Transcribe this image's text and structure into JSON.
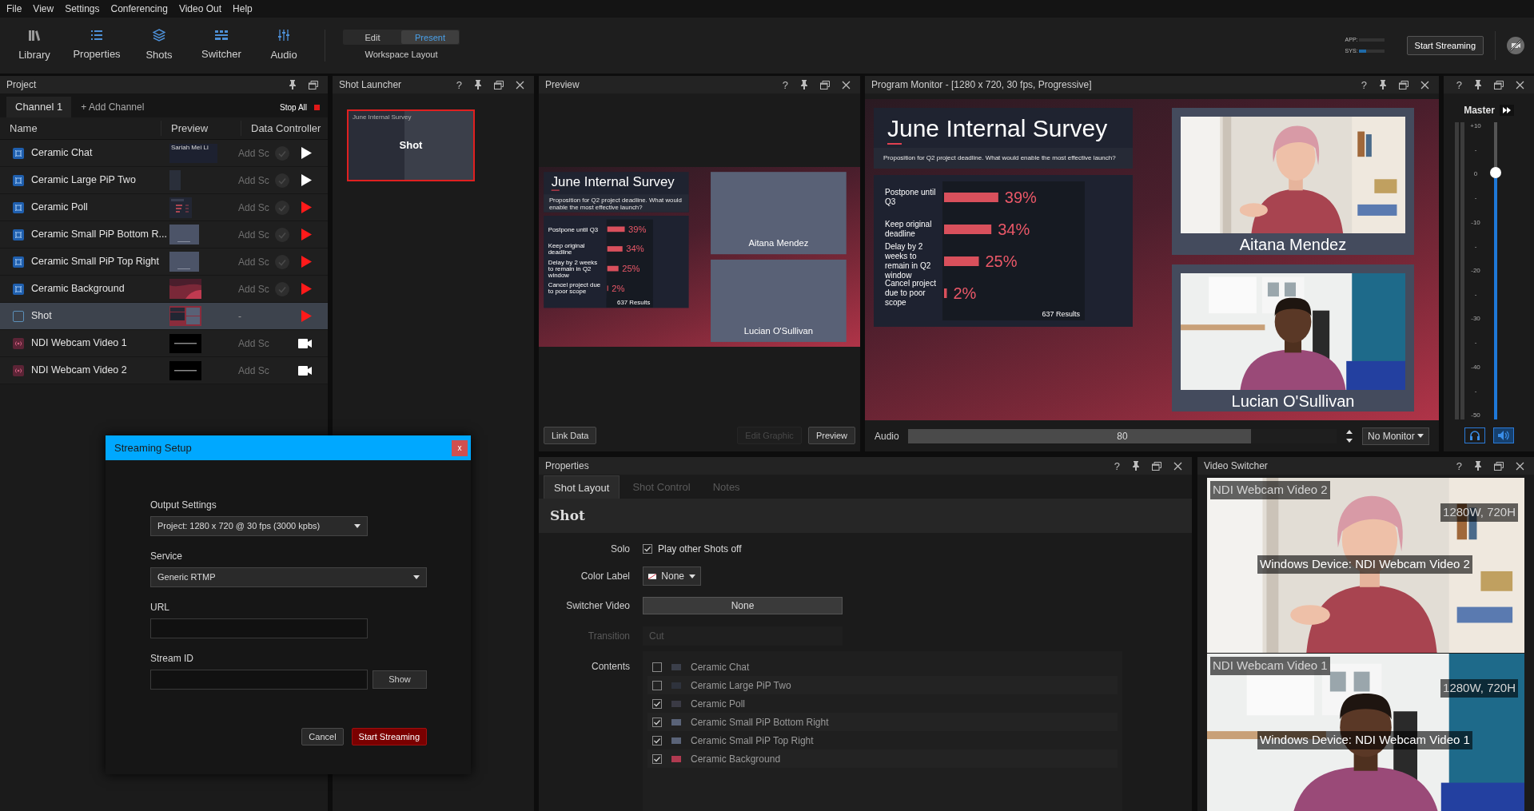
{
  "menu": [
    "File",
    "View",
    "Settings",
    "Conferencing",
    "Video Out",
    "Help"
  ],
  "toolbar": [
    {
      "label": "Library",
      "kind": "library"
    },
    {
      "label": "Properties",
      "kind": "properties"
    },
    {
      "label": "Shots",
      "kind": "shots"
    },
    {
      "label": "Switcher",
      "kind": "switcher"
    },
    {
      "label": "Audio",
      "kind": "audio"
    }
  ],
  "workspace": {
    "modes": [
      {
        "label": "Edit",
        "selected": false
      },
      {
        "label": "Present",
        "selected": true
      }
    ],
    "caption": "Workspace Layout"
  },
  "meters": [
    {
      "label": "APP:"
    },
    {
      "label": "SYS:",
      "level": 0.3
    }
  ],
  "start_streaming": "Start Streaming",
  "project": {
    "title": "Project",
    "closable": false,
    "channel_tabs": [
      {
        "label": "Channel 1",
        "selected": true
      }
    ],
    "add_channel": "+ Add Channel",
    "stop_all": "Stop All",
    "columns": [
      "Name",
      "Preview",
      "Data Controller"
    ],
    "rows": [
      {
        "name": "Ceramic Chat",
        "kind": "layer",
        "thumb_caption": "Sariah Mei Li",
        "data_controller": "Add Sc",
        "has_check": true,
        "live": false,
        "selected": false
      },
      {
        "name": "Ceramic Large PiP Two",
        "kind": "layer",
        "data_controller": "Add Sc",
        "has_check": true,
        "live": false,
        "selected": false
      },
      {
        "name": "Ceramic Poll",
        "kind": "layer",
        "data_controller": "Add Sc",
        "has_check": true,
        "live": true,
        "selected": false
      },
      {
        "name": "Ceramic Small PiP Bottom R...",
        "kind": "layer",
        "data_controller": "Add Sc",
        "has_check": true,
        "live": true,
        "selected": false
      },
      {
        "name": "Ceramic Small PiP Top Right",
        "kind": "layer",
        "data_controller": "Add Sc",
        "has_check": true,
        "live": true,
        "selected": false
      },
      {
        "name": "Ceramic Background",
        "kind": "layer",
        "data_controller": "Add Sc",
        "has_check": true,
        "live": true,
        "selected": false
      },
      {
        "name": "Shot",
        "kind": "shot",
        "data_controller": "-",
        "has_check": false,
        "live": true,
        "selected": true
      },
      {
        "name": "NDI Webcam Video 1",
        "kind": "ndi",
        "data_controller": "Add Sc",
        "has_check": false,
        "live": false,
        "selected": false
      },
      {
        "name": "NDI Webcam Video 2",
        "kind": "ndi",
        "data_controller": "Add Sc",
        "has_check": false,
        "live": false,
        "selected": false
      }
    ]
  },
  "shot_launcher": {
    "title": "Shot Launcher",
    "help": "?",
    "closable": true,
    "tiles": [
      {
        "label": "Shot",
        "caption": "June Internal Survey",
        "selected": true
      }
    ]
  },
  "preview": {
    "title": "Preview",
    "help": "?",
    "closable": true,
    "slide": {
      "title": "June Internal Survey",
      "subtitle": "Proposition for Q2 project deadline. What would enable the most effective launch?",
      "chart_data": {
        "type": "bar",
        "orientation": "horizontal",
        "categories": [
          "Postpone until Q3",
          "Keep original deadline",
          "Delay by 2 weeks to remain in Q2 window",
          "Cancel project due to poor scope"
        ],
        "values": [
          39,
          34,
          25,
          2
        ],
        "value_labels": [
          "39%",
          "34%",
          "25%",
          "2%"
        ]
      },
      "results": "637 Results",
      "cards": [
        {
          "name": "Aitana Mendez",
          "kind": "blank"
        },
        {
          "name": "Lucian O'Sullivan",
          "kind": "blank"
        }
      ]
    },
    "buttons": [
      {
        "label": "Link Data",
        "disabled": false
      },
      {
        "label": "Edit Graphic",
        "disabled": true
      },
      {
        "label": "Preview",
        "disabled": false
      }
    ]
  },
  "program": {
    "title": "Program Monitor - [1280 x 720, 30 fps, Progressive]",
    "help": "?",
    "closable": true,
    "slide": {
      "title": "June Internal Survey",
      "subtitle": "Proposition for Q2 project deadline. What would enable the most effective launch?",
      "chart_data": {
        "type": "bar",
        "orientation": "horizontal",
        "categories": [
          "Postpone until Q3",
          "Keep original deadline",
          "Delay by 2 weeks to remain in Q2 window",
          "Cancel project due to poor scope"
        ],
        "values": [
          39,
          34,
          25,
          2
        ],
        "value_labels": [
          "39%",
          "34%",
          "25%",
          "2%"
        ]
      },
      "results": "637 Results",
      "cards": [
        {
          "name": "Aitana Mendez",
          "kind": "picture"
        },
        {
          "name": "Lucian O'Sullivan",
          "kind": "picture"
        }
      ]
    },
    "audio": {
      "label": "Audio",
      "level": 0.8,
      "reading": "80"
    },
    "monitor": "No Monitor"
  },
  "master": {
    "help": "?",
    "closable": true,
    "label": "Master",
    "scale": [
      "+10",
      "-",
      "0",
      "-",
      "-10",
      "-",
      "-20",
      "-",
      "-30",
      "-",
      "-40",
      "-",
      "-50"
    ],
    "level": 0.83,
    "buttons": [
      {
        "kind": "headphones",
        "on": false
      },
      {
        "kind": "speaker",
        "on": true
      }
    ]
  },
  "properties": {
    "title": "Properties",
    "help": "?",
    "closable": true,
    "tabs": [
      {
        "label": "Shot Layout",
        "selected": true
      },
      {
        "label": "Shot Control",
        "selected": false
      },
      {
        "label": "Notes",
        "selected": false
      }
    ],
    "heading": "Shot",
    "solo": {
      "label": "Solo",
      "text": "Play other Shots off",
      "checked": true
    },
    "color_label": {
      "label": "Color Label",
      "value": "None"
    },
    "switcher_video": {
      "label": "Switcher Video",
      "value": "None"
    },
    "transition": {
      "label": "Transition",
      "value": "Cut",
      "disabled": true
    },
    "contents": {
      "label": "Contents",
      "items": [
        {
          "name": "Ceramic Chat",
          "checked": false,
          "color": "#3b3f4a"
        },
        {
          "name": "Ceramic Large PiP Two",
          "checked": false,
          "color": "#2e323c"
        },
        {
          "name": "Ceramic Poll",
          "checked": true,
          "color": "#3a3a44"
        },
        {
          "name": "Ceramic Small PiP Bottom Right",
          "checked": true,
          "color": "#5a6378"
        },
        {
          "name": "Ceramic Small PiP Top Right",
          "checked": true,
          "color": "#5a6378"
        },
        {
          "name": "Ceramic Background",
          "checked": true,
          "color": "#b03a50"
        }
      ]
    }
  },
  "video_switcher": {
    "title": "Video Switcher",
    "help": "?",
    "closable": true,
    "sources": [
      {
        "name": "NDI Webcam Video 2",
        "resolution": "1280W, 720H",
        "device": "Windows Device: NDI Webcam Video 2"
      },
      {
        "name": "NDI Webcam Video 1",
        "resolution": "1280W, 720H",
        "device": "Windows Device: NDI Webcam Video 1"
      }
    ]
  },
  "dialog": {
    "title": "Streaming Setup",
    "close": "x",
    "fields": [
      {
        "kind": "select",
        "label": "Output Settings",
        "value": "Project: 1280 x 720 @ 30 fps (3000 kpbs)",
        "wide": false
      },
      {
        "kind": "select",
        "label": "Service",
        "value": "Generic RTMP",
        "wide": true
      },
      {
        "kind": "input",
        "label": "URL"
      },
      {
        "kind": "secret",
        "label": "Stream ID",
        "button": "Show"
      }
    ],
    "buttons": [
      {
        "label": "Cancel",
        "kind": "secondary"
      },
      {
        "label": "Start Streaming",
        "kind": "primary"
      }
    ]
  }
}
